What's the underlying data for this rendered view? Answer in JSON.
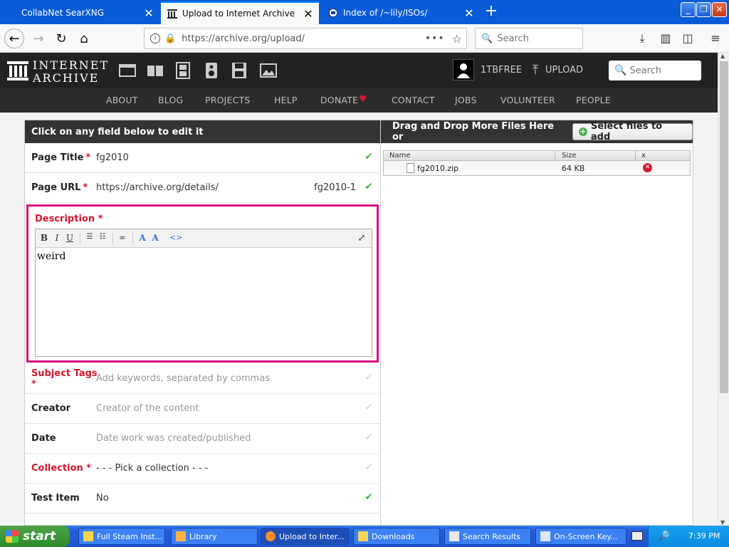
{
  "browser": {
    "tabs": [
      {
        "title": "CollabNet SearXNG",
        "active": false
      },
      {
        "title": "Upload to Internet Archive",
        "active": true
      },
      {
        "title": "Index of /~lily/ISOs/",
        "active": false
      }
    ],
    "url": "https://archive.org/upload/",
    "search_placeholder": "Search"
  },
  "ia": {
    "logo_line1": "INTERNET",
    "logo_line2": "ARCHIVE",
    "username": "1TBFREE",
    "upload_label": "UPLOAD",
    "search_placeholder": "Search",
    "nav": [
      "ABOUT",
      "BLOG",
      "PROJECTS",
      "HELP",
      "DONATE",
      "CONTACT",
      "JOBS",
      "VOLUNTEER",
      "PEOPLE"
    ],
    "donate_heart_color": "#d3172e"
  },
  "form": {
    "header": "Click on any field below to edit it",
    "page_title": {
      "label": "Page Title",
      "value": "fg2010"
    },
    "page_url": {
      "label": "Page URL",
      "prefix": "https://archive.org/details/",
      "value": "fg2010-1"
    },
    "description": {
      "label": "Description",
      "text": "weird"
    },
    "subject_tags": {
      "label": "Subject Tags",
      "placeholder": "Add keywords, separated by commas"
    },
    "creator": {
      "label": "Creator",
      "placeholder": "Creator of the content"
    },
    "date": {
      "label": "Date",
      "placeholder": "Date work was created/published"
    },
    "collection": {
      "label": "Collection",
      "value": "- - - Pick a collection - - -"
    },
    "test_item": {
      "label": "Test Item",
      "value": "No"
    }
  },
  "files": {
    "drop_text": "Drag and Drop More Files Here or",
    "select_button": "Select files to add",
    "columns": [
      "Name",
      "Size",
      "x"
    ],
    "rows": [
      {
        "name": "fg2010.zip",
        "size": "64 KB"
      }
    ]
  },
  "taskbar": {
    "start_label": "start",
    "tasks": [
      "Full Steam Inst...",
      "Library",
      "Upload to Inter...",
      "Downloads",
      "Search Results",
      "On-Screen Key..."
    ],
    "clock": "7:39 PM"
  },
  "colors": {
    "accent_required": "#d3172e",
    "focus_border": "#d5147f",
    "check": "#4caf50"
  }
}
